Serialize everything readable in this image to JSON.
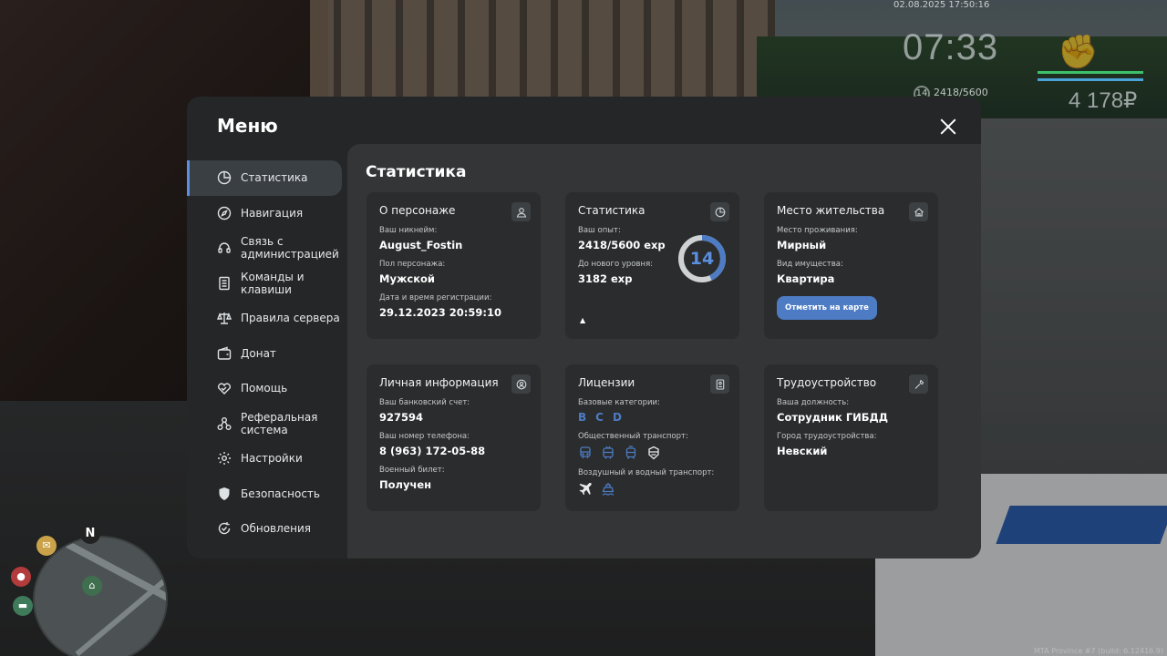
{
  "hud": {
    "datetime": "02.08.2025 17:50:16",
    "time": "07:33",
    "level": "14",
    "exp": "2418/5600",
    "money": "4 178₽",
    "build": "MTA Province #7 (build: 6.12416.9)"
  },
  "menu": {
    "title": "Меню",
    "sidebar": [
      {
        "label": "Статистика",
        "icon": "pie-chart-icon",
        "active": true
      },
      {
        "label": "Навигация",
        "icon": "compass-icon"
      },
      {
        "label": "Связь с администрацией",
        "icon": "headset-icon"
      },
      {
        "label": "Команды и клавиши",
        "icon": "document-icon"
      },
      {
        "label": "Правила сервера",
        "icon": "scales-icon"
      },
      {
        "label": "Донат",
        "icon": "wallet-icon"
      },
      {
        "label": "Помощь",
        "icon": "handshake-icon"
      },
      {
        "label": "Реферальная система",
        "icon": "referral-icon"
      },
      {
        "label": "Настройки",
        "icon": "gear-icon"
      },
      {
        "label": "Безопасность",
        "icon": "shield-icon"
      },
      {
        "label": "Обновления",
        "icon": "update-icon"
      }
    ]
  },
  "content": {
    "title": "Статистика",
    "character": {
      "title": "О персонаже",
      "nick_label": "Ваш никнейм:",
      "nick": "August_Fostin",
      "gender_label": "Пол персонажа:",
      "gender": "Мужской",
      "reg_label": "Дата и время регистрации:",
      "reg": "29.12.2023 20:59:10"
    },
    "stats": {
      "title": "Статистика",
      "exp_label": "Ваш опыт:",
      "exp": "2418/5600 exp",
      "next_label": "До нового уровня:",
      "next": "3182 exp",
      "level": "14",
      "level_progress": 0.432
    },
    "residence": {
      "title": "Место жительства",
      "place_label": "Место проживания:",
      "place": "Мирный",
      "type_label": "Вид имущества:",
      "type": "Квартира",
      "button": "Отметить на карте"
    },
    "personal": {
      "title": "Личная информация",
      "bank_label": "Ваш банковский счет:",
      "bank": "927594",
      "phone_label": "Ваш номер телефона:",
      "phone": "8 (963) 172-05-88",
      "military_label": "Военный билет:",
      "military": "Получен"
    },
    "licenses": {
      "title": "Лицензии",
      "base_label": "Базовые категории:",
      "base": [
        "B",
        "C",
        "D"
      ],
      "public_label": "Общественный транспорт:",
      "air_label": "Воздушный и водный транспорт:"
    },
    "job": {
      "title": "Трудоустройство",
      "position_label": "Ваша должность:",
      "position": "Сотрудник ГИБДД",
      "city_label": "Город трудоустройства:",
      "city": "Невский"
    }
  },
  "colors": {
    "accent": "#5b8fe0",
    "button": "#4d7cc4",
    "panel": "#242627",
    "content": "#333536",
    "card": "#2a2c2d"
  }
}
